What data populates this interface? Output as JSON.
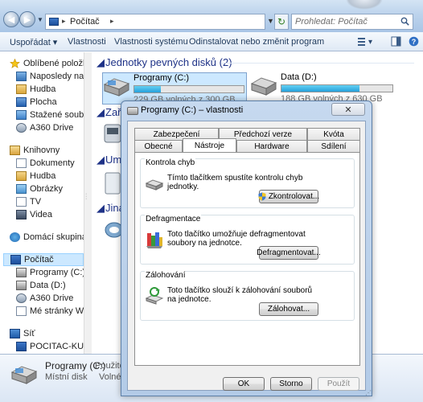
{
  "colors": {
    "accent": "#26a0da",
    "group_header": "#1e3287",
    "selection": "#cce8ff"
  },
  "addressbar": {
    "location": "Počítač"
  },
  "search": {
    "placeholder": "Prohledat: Počítač"
  },
  "toolbar": {
    "organize": "Uspořádat ▾",
    "properties": "Vlastnosti",
    "system_properties": "Vlastnosti systému",
    "uninstall": "Odinstalovat nebo změnit program",
    "icons": [
      "view-options-icon",
      "preview-pane-icon",
      "help-icon"
    ]
  },
  "sidebar": {
    "favorites": {
      "label": "Oblíbené položky",
      "items": [
        "Naposledy navští",
        "Hudba",
        "Plocha",
        "Stažené soubory",
        "A360 Drive"
      ]
    },
    "libraries": {
      "label": "Knihovny",
      "items": [
        "Dokumenty",
        "Hudba",
        "Obrázky",
        "TV",
        "Videa"
      ]
    },
    "homegroup": {
      "label": "Domácí skupina"
    },
    "computer": {
      "label": "Počítač",
      "items": [
        "Programy (C:)",
        "Data (D:)",
        "A360 Drive",
        "Mé stránky WWW"
      ]
    },
    "network": {
      "label": "Síť",
      "items": [
        "POCITAC-KUCH"
      ]
    }
  },
  "content": {
    "group_hdd": "Jednotky pevných disků (2)",
    "group_devices_partial": "Zaří",
    "group_removable_partial": "Umí",
    "group_other_partial": "Jiná",
    "drives": [
      {
        "name": "Programy (C:)",
        "free_text": "229 GB volných z 300 GB",
        "used_fraction": 0.24
      },
      {
        "name": "Data (D:)",
        "free_text": "188 GB volných z 630 GB",
        "used_fraction": 0.7
      }
    ]
  },
  "details": {
    "name": "Programy (C:)",
    "used_label": "Použité m",
    "type": "Místní disk",
    "free_label": "Volné m"
  },
  "dialog": {
    "title": "Programy (C:) – vlastnosti",
    "close_label": "✕",
    "tabs_row1": [
      "Zabezpečení",
      "Předchozí verze",
      "Kvóta"
    ],
    "tabs_row2": [
      "Obecné",
      "Nástroje",
      "Hardware",
      "Sdílení"
    ],
    "active_tab": "Nástroje",
    "sections": [
      {
        "title": "Kontrola chyb",
        "text": "Tímto tlačítkem spustíte kontrolu chyb jednotky.",
        "button": "Zkontrolovat..."
      },
      {
        "title": "Defragmentace",
        "text": "Toto tlačítko umožňuje defragmentovat soubory na jednotce.",
        "button": "Defragmentovat..."
      },
      {
        "title": "Zálohování",
        "text": "Toto tlačítko slouží k zálohování souborů na jednotce.",
        "button": "Zálohovat..."
      }
    ],
    "buttons": {
      "ok": "OK",
      "cancel": "Storno",
      "apply": "Použít"
    }
  }
}
